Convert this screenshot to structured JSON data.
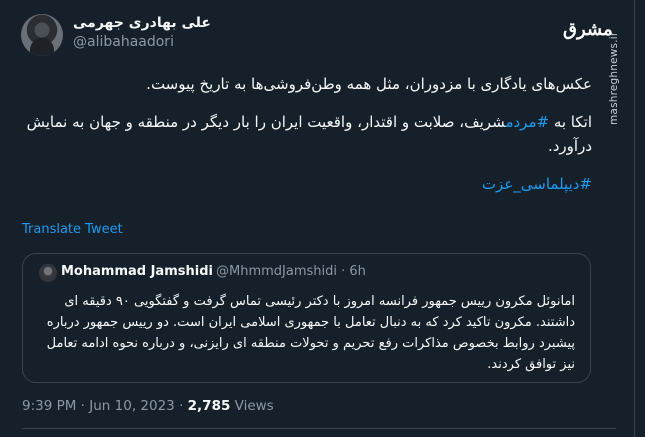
{
  "author": {
    "name": "علی بهادری جهرمی",
    "handle": "@alibahaadori"
  },
  "watermark": "mashreghnews.ir",
  "logo_text": "مشرق",
  "tweet": {
    "line1": "عکس‌های یادگاری با مزدوران، مثل همه وطن‌فروشی‌ها به تاریخ پیوست.",
    "p2_prefix": "اتکا به ",
    "p2_hashtag": "#مردم",
    "p2_rest": "شریف، صلابت و اقتدار، واقعیت ایران را بار دیگر در منطقه و جهان به نمایش درآورد.",
    "hashtag2": "#دیپلماسی_عزت"
  },
  "translate_label": "Translate Tweet",
  "quote": {
    "name": "Mohammad Jamshidi",
    "handle_time": "@MhmmdJamshidi · 6h",
    "text": "امانوئل مکرون رییس جمهور فرانسه امروز با دکتر رئیسی تماس گرفت و گفتگویی ۹۰ دقیقه ای داشتند. مکرون تاکید کرد که به دنبال تعامل با جمهوری اسلامی ایران است. دو رییس جمهور درباره پیشبرد روابط بخصوص مذاکرات رفع تحریم و تحولات منطقه ای رایزنی، و درباره نحوه ادامه تعامل نیز توافق کردند."
  },
  "meta": {
    "time_date": "9:39 PM · Jun 10, 2023 · ",
    "views_count": "2,785",
    "views_label": " Views"
  }
}
